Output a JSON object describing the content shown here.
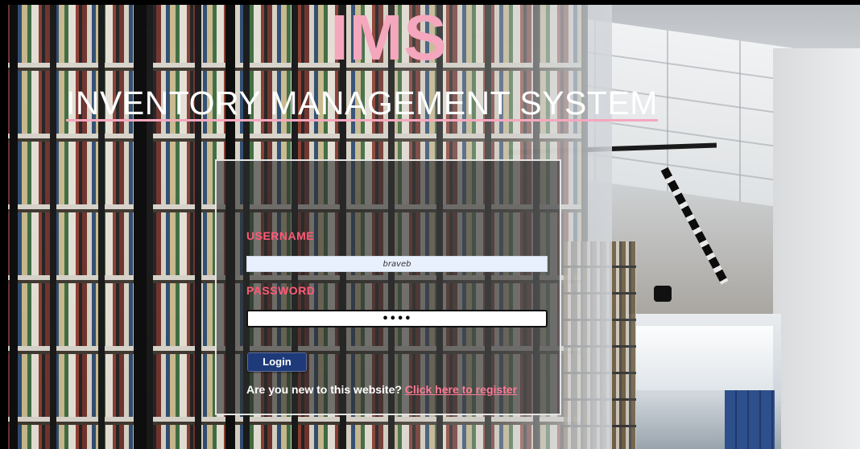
{
  "header": {
    "brand": "IMS",
    "subtitle": "INVENTORY MANAGEMENT SYSTEM"
  },
  "login_form": {
    "username_label": "USERNAME",
    "username_value": "braveb",
    "password_label": "PASSWORD",
    "password_value": "••••",
    "login_button": "Login",
    "register_prompt": "Are you new to this website?",
    "register_link": "Click here to register"
  },
  "colors": {
    "accent_pink": "#f4a7bd",
    "label_pink": "#ff5a78",
    "button_blue": "#1e3a78",
    "card_overlay": "rgba(45,45,45,0.62)"
  }
}
